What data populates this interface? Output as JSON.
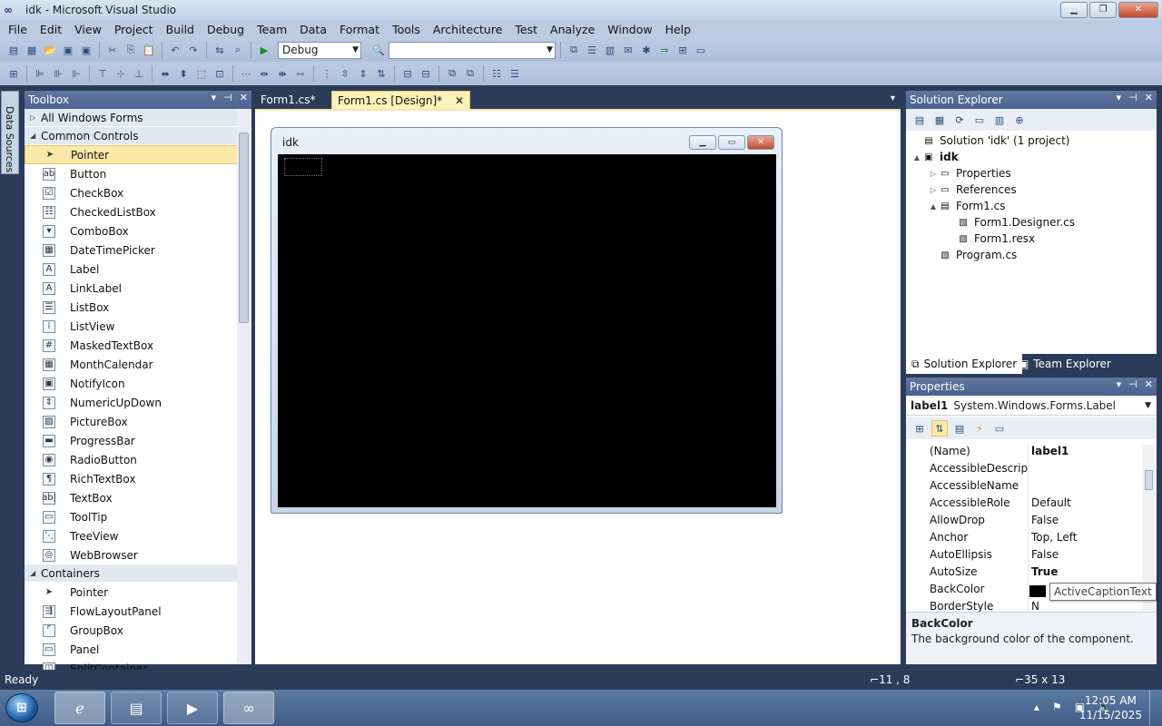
{
  "window": {
    "title": "idk - Microsoft Visual Studio"
  },
  "menu": [
    "File",
    "Edit",
    "View",
    "Project",
    "Build",
    "Debug",
    "Team",
    "Data",
    "Format",
    "Tools",
    "Architecture",
    "Test",
    "Analyze",
    "Window",
    "Help"
  ],
  "toolbar": {
    "config": "Debug",
    "platform": ""
  },
  "side_tabs": {
    "data_sources": "Data Sources"
  },
  "toolbox": {
    "title": "Toolbox",
    "groups": [
      {
        "label": "All Windows Forms",
        "expanded": false
      },
      {
        "label": "Common Controls",
        "expanded": true
      },
      {
        "label": "Containers",
        "expanded": true
      }
    ],
    "common_items": [
      "Pointer",
      "Button",
      "CheckBox",
      "CheckedListBox",
      "ComboBox",
      "DateTimePicker",
      "Label",
      "LinkLabel",
      "ListBox",
      "ListView",
      "MaskedTextBox",
      "MonthCalendar",
      "NotifyIcon",
      "NumericUpDown",
      "PictureBox",
      "ProgressBar",
      "RadioButton",
      "RichTextBox",
      "TextBox",
      "ToolTip",
      "TreeView",
      "WebBrowser"
    ],
    "container_items": [
      "Pointer",
      "FlowLayoutPanel",
      "GroupBox",
      "Panel",
      "SplitContainer"
    ],
    "selected": "Pointer"
  },
  "doc_tabs": [
    {
      "label": "Form1.cs*",
      "active": false
    },
    {
      "label": "Form1.cs [Design]*",
      "active": true
    }
  ],
  "designer": {
    "form_title": "idk"
  },
  "solution_explorer": {
    "title": "Solution Explorer",
    "items": [
      {
        "label": "Solution 'idk' (1 project)",
        "level": 0,
        "arrow": "",
        "icon": "solution-icon"
      },
      {
        "label": "idk",
        "level": 0,
        "arrow": "▲",
        "icon": "project-icon",
        "bold": true
      },
      {
        "label": "Properties",
        "level": 1,
        "arrow": "▷",
        "icon": "folder-icon"
      },
      {
        "label": "References",
        "level": 1,
        "arrow": "▷",
        "icon": "folder-icon"
      },
      {
        "label": "Form1.cs",
        "level": 1,
        "arrow": "▲",
        "icon": "form-icon"
      },
      {
        "label": "Form1.Designer.cs",
        "level": 2,
        "arrow": "",
        "icon": "cs-file-icon"
      },
      {
        "label": "Form1.resx",
        "level": 2,
        "arrow": "",
        "icon": "resx-file-icon"
      },
      {
        "label": "Program.cs",
        "level": 1,
        "arrow": "",
        "icon": "cs-file-icon"
      }
    ],
    "tabs": [
      "Solution Explorer",
      "Team Explorer"
    ]
  },
  "properties": {
    "title": "Properties",
    "object_name": "label1",
    "object_type": "System.Windows.Forms.Label",
    "rows": [
      {
        "name": "(Name)",
        "value": "label1",
        "bold": true
      },
      {
        "name": "AccessibleDescriptic",
        "value": "",
        "bold": false
      },
      {
        "name": "AccessibleName",
        "value": "",
        "bold": false
      },
      {
        "name": "AccessibleRole",
        "value": "Default",
        "bold": false
      },
      {
        "name": "AllowDrop",
        "value": "False",
        "bold": false
      },
      {
        "name": "Anchor",
        "value": "Top, Left",
        "bold": false
      },
      {
        "name": "AutoEllipsis",
        "value": "False",
        "bold": false
      },
      {
        "name": "AutoSize",
        "value": "True",
        "bold": true
      },
      {
        "name": "BackColor",
        "value": "",
        "bold": false
      },
      {
        "name": "BorderStyle",
        "value": "N",
        "bold": false
      }
    ],
    "tooltip": "ActiveCaptionText",
    "desc_title": "BackColor",
    "desc_text": "The background color of the component."
  },
  "status": {
    "ready": "Ready",
    "position": "11 , 8",
    "size": "35 x 13"
  },
  "taskbar": {
    "time": "12:05 AM",
    "date": "11/15/2025"
  }
}
